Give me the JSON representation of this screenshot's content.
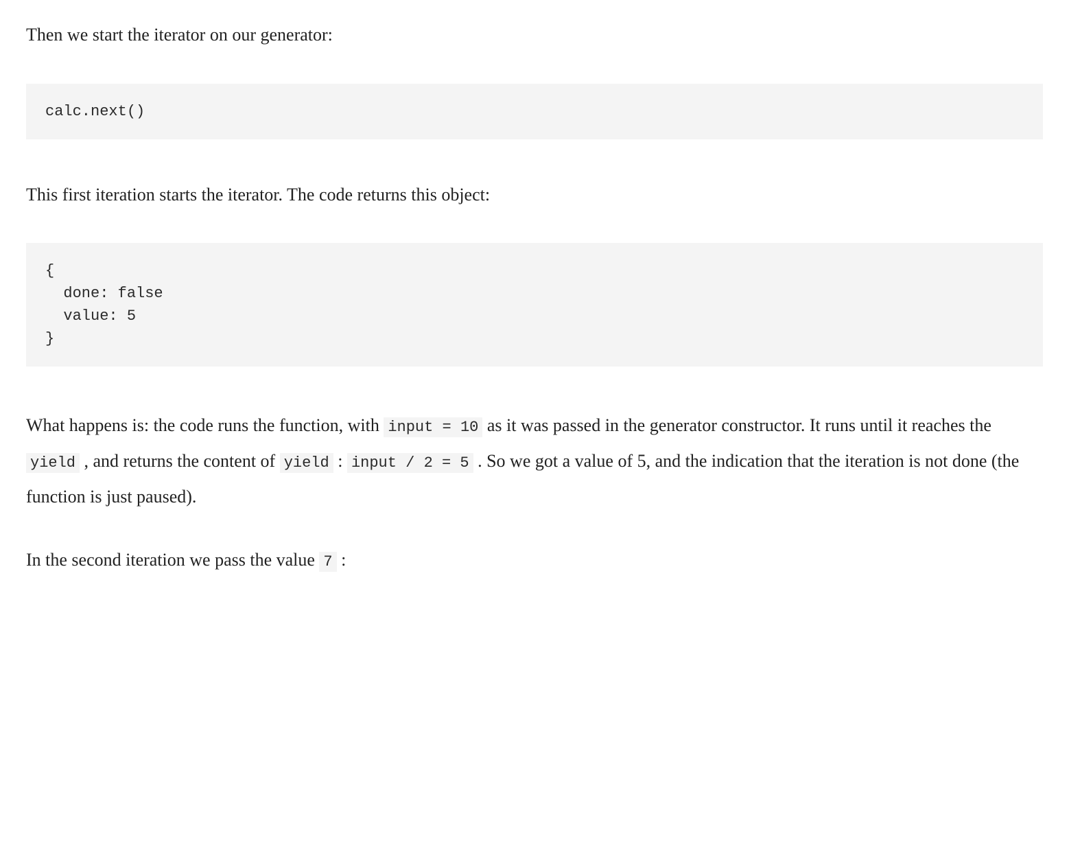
{
  "paragraphs": {
    "p1": "Then we start the iterator on our generator:",
    "p2": "This first iteration starts the iterator. The code returns this object:",
    "p3_part1": "What happens is: the code runs the function, with ",
    "p3_code1": "input = 10",
    "p3_part2": " as it was passed in the generator constructor. It runs until it reaches the ",
    "p3_code2": "yield",
    "p3_part3": " , and returns the content of ",
    "p3_code3": "yield",
    "p3_part4": " : ",
    "p3_code4": "input / 2 = 5",
    "p3_part5": " . So we got a value of 5, and the indication that the iteration is not done (the function is just paused).",
    "p4_part1": "In the second iteration we pass the value ",
    "p4_code1": "7",
    "p4_part2": " :"
  },
  "codeblocks": {
    "block1": "calc.next()",
    "block2": "{\n  done: false\n  value: 5\n}"
  }
}
